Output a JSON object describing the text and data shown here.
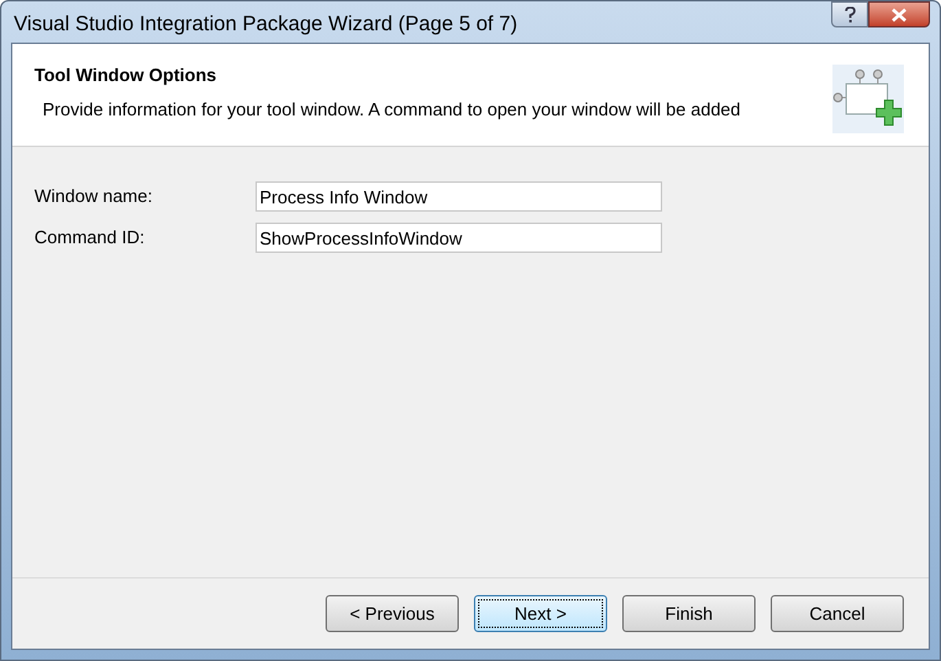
{
  "window": {
    "title": "Visual Studio Integration Package Wizard (Page 5 of 7)"
  },
  "header": {
    "title": "Tool Window Options",
    "description": "Provide information for your tool window. A command to open your window will be added"
  },
  "fields": [
    {
      "label": "Window name:",
      "value": "Process Info Window"
    },
    {
      "label": "Command ID:",
      "value": "ShowProcessInfoWindow"
    }
  ],
  "buttons": [
    {
      "label": "< Previous",
      "focused": false
    },
    {
      "label": "Next >",
      "focused": true
    },
    {
      "label": "Finish",
      "focused": false
    },
    {
      "label": "Cancel",
      "focused": false
    }
  ]
}
